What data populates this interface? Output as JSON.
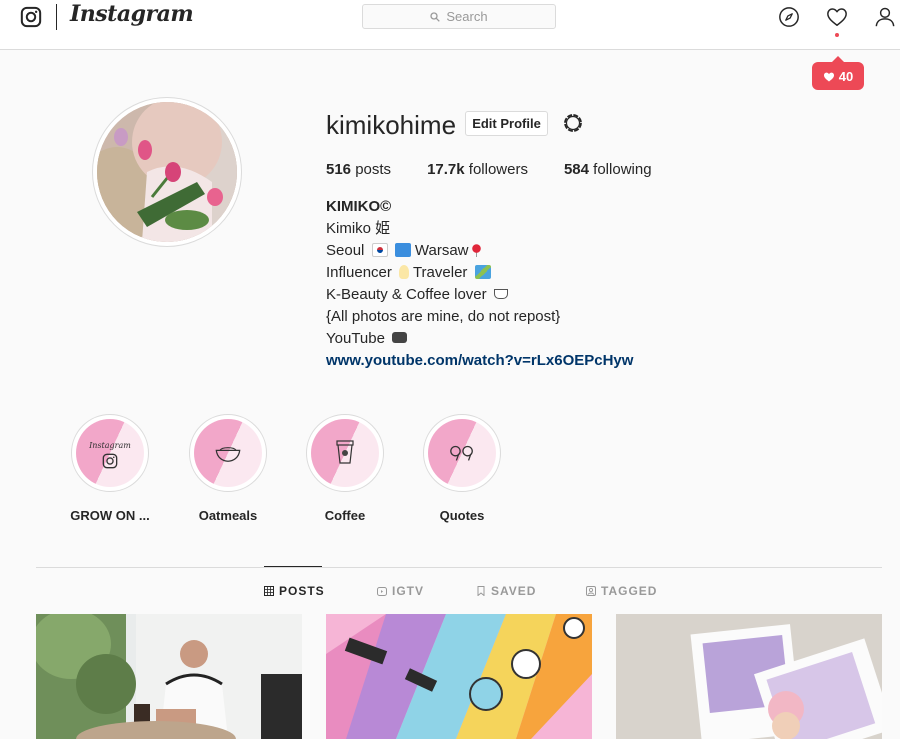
{
  "nav": {
    "wordmark": "Instagram",
    "search_placeholder": "Search",
    "icons": [
      "instagram-logo-icon",
      "search-icon",
      "explore-compass-icon",
      "heart-icon",
      "user-icon"
    ],
    "activity_count": "40"
  },
  "profile": {
    "username": "kimikohime",
    "edit_label": "Edit Profile",
    "stats": {
      "posts_count": "516",
      "posts_label": "posts",
      "followers_count": "17.7k",
      "followers_label": "followers",
      "following_count": "584",
      "following_label": "following"
    },
    "bio": {
      "name": "KIMIKO©",
      "line1": "Kimiko 姫",
      "line2a": "Seoul",
      "line2b": "Warsaw",
      "line3a": "Influencer",
      "line3b": "Traveler",
      "line4": "K-Beauty & Coffee lover",
      "line5": "{All photos are mine, do not repost}",
      "line6": "YouTube",
      "link": "www.youtube.com/watch?v=rLx6OEPcHyw"
    }
  },
  "highlights": [
    {
      "label": "GROW ON ...",
      "cover_text": "Instagram"
    },
    {
      "label": "Oatmeals"
    },
    {
      "label": "Coffee"
    },
    {
      "label": "Quotes"
    }
  ],
  "tabs": [
    {
      "label": "POSTS",
      "active": true
    },
    {
      "label": "IGTV",
      "active": false
    },
    {
      "label": "SAVED",
      "active": false
    },
    {
      "label": "TAGGED",
      "active": false
    }
  ],
  "colors": {
    "accent_red": "#ed4956",
    "link_blue": "#003569",
    "highlight_pink": "#f2a7c9"
  }
}
